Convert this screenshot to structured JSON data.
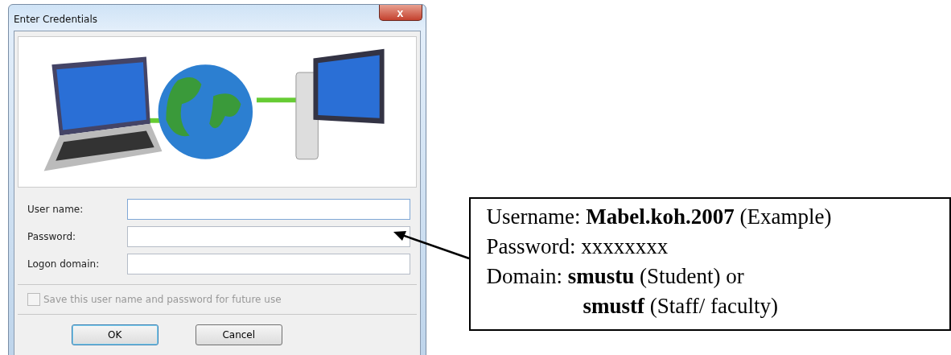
{
  "window": {
    "title": "Enter Credentials",
    "close_button": "x"
  },
  "fields": [
    {
      "label": "User name:",
      "focused": true
    },
    {
      "label": "Password:",
      "focused": false
    },
    {
      "label": "Logon domain:",
      "focused": false
    }
  ],
  "save_option": {
    "label": "Save this user name and password for future use",
    "checked": false,
    "disabled": true
  },
  "buttons": [
    {
      "label": "OK",
      "default": true
    },
    {
      "label": "Cancel",
      "default": false
    }
  ],
  "callout": {
    "lines": [
      "Username: **Mabel.koh.2007** (Example)",
      "Password: xxxxxxxx",
      "Domain: **smustu** (Student) or"
    ],
    "continuation": "**smustf** (Staff/ faculty)"
  }
}
